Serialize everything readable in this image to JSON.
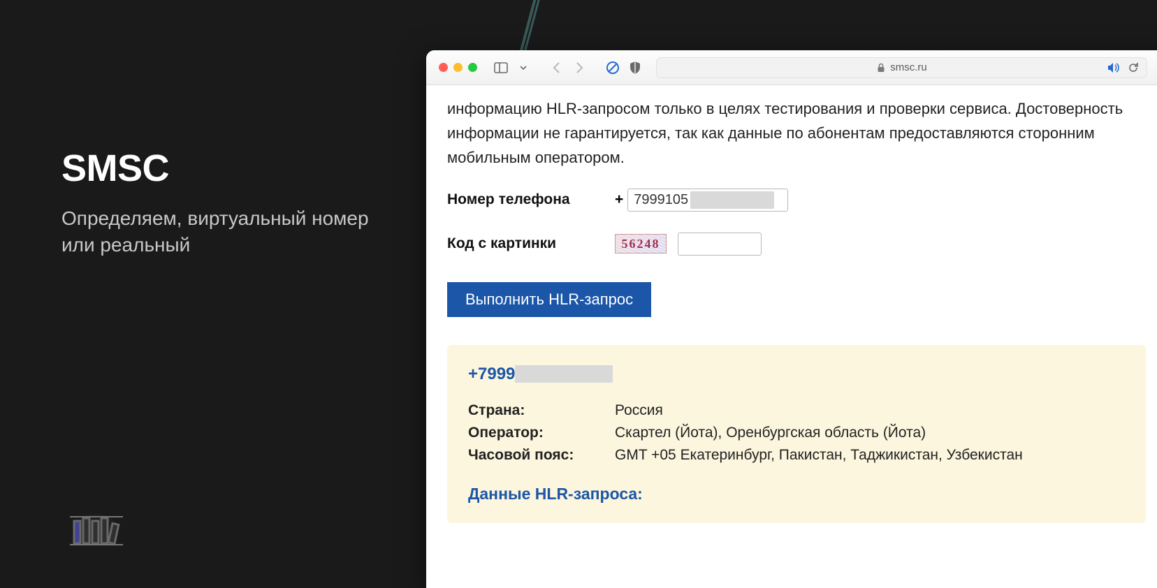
{
  "left": {
    "title": "SMSC",
    "subtitle": "Определяем, виртуальный номер или реальный"
  },
  "browser": {
    "address": "smsc.ru"
  },
  "page": {
    "intro": "информацию HLR-запросом только в целях тестирования и проверки сервиса. Достоверность информации не гарантируется, так как данные по абонентам предоставляются сторонним мобильным оператором.",
    "phone_label": "Номер телефона",
    "phone_prefix": "+",
    "phone_value": "7999105",
    "captcha_label": "Код с картинки",
    "captcha_text": "56248",
    "captcha_value": "",
    "submit": "Выполнить HLR-запрос"
  },
  "result": {
    "phone_prefix": "+7999",
    "rows": [
      {
        "k": "Страна:",
        "v": "Россия"
      },
      {
        "k": "Оператор:",
        "v": "Скартел (Йота), Оренбургская область (Йота)"
      },
      {
        "k": "Часовой пояс:",
        "v": "GMT +05 Екатеринбург, Пакистан, Таджикистан, Узбекистан"
      }
    ],
    "section": "Данные HLR-запроса:"
  }
}
